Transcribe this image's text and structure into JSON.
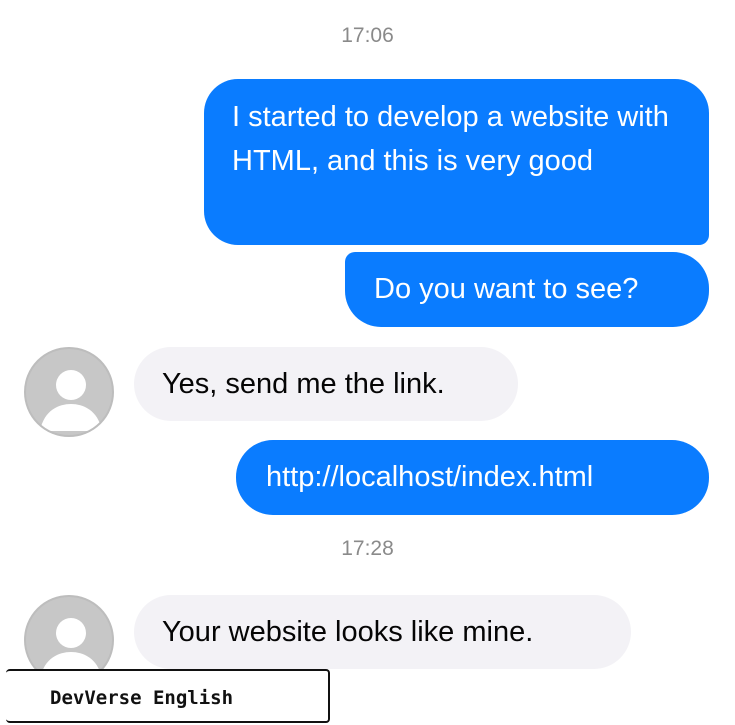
{
  "conversation": {
    "timestamps": [
      "17:06",
      "17:28"
    ],
    "messages": [
      {
        "sender": "me",
        "text": "I started to develop a website with HTML, and this is very good"
      },
      {
        "sender": "me",
        "text": "Do you want to see?"
      },
      {
        "sender": "contact",
        "text": "Yes, send me the link."
      },
      {
        "sender": "me",
        "text": "http://localhost/index.html"
      },
      {
        "sender": "contact",
        "text": "Your website looks like mine."
      }
    ]
  },
  "avatar": {
    "icon": "user-icon"
  },
  "watermark": {
    "text": "DevVerse English"
  },
  "colors": {
    "outgoing_bubble": "#0a7cff",
    "incoming_bubble": "#f3f2f6",
    "timestamp": "#8a8a8a",
    "avatar": "#c7c7c7"
  }
}
